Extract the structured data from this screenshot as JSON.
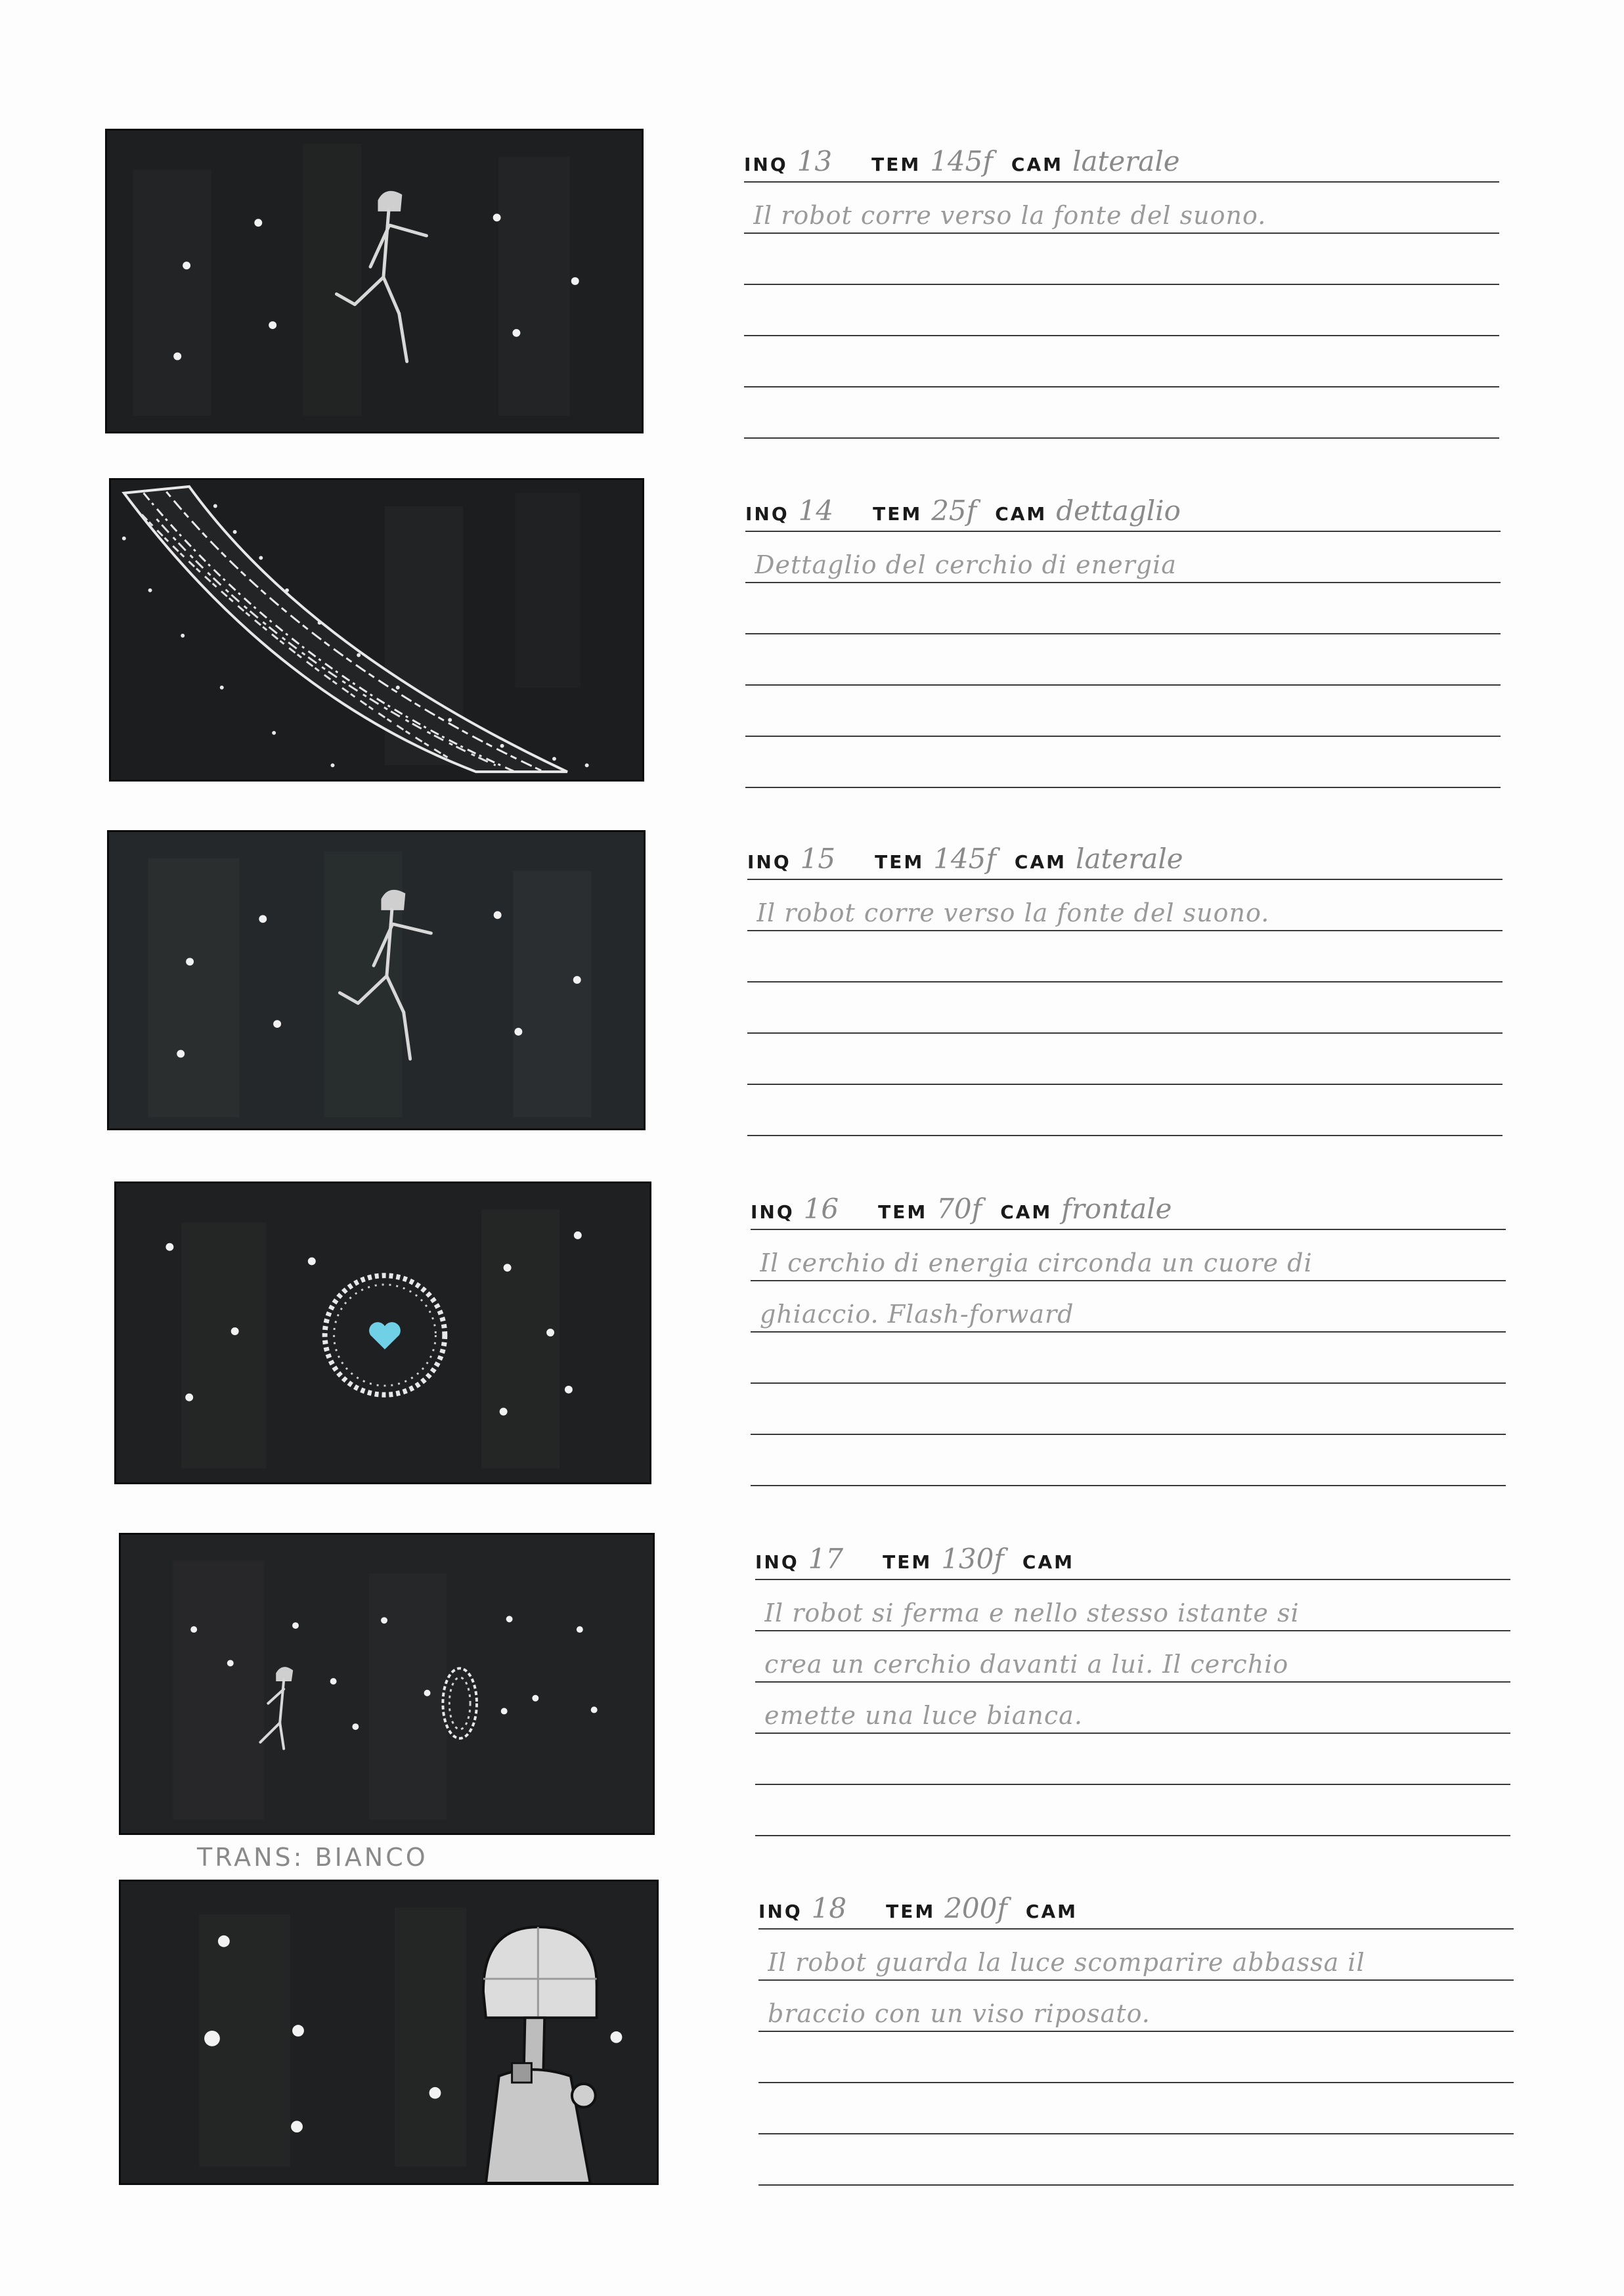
{
  "labels": {
    "inq": "INQ",
    "tem": "TEM",
    "cam": "CAM"
  },
  "shots": [
    {
      "inq": "13",
      "tem": "145f",
      "cam": "laterale",
      "lines": [
        "Il robot corre verso la fonte del suono.",
        "",
        "",
        "",
        ""
      ]
    },
    {
      "inq": "14",
      "tem": "25f",
      "cam": "dettaglio",
      "lines": [
        "Dettaglio del cerchio di energia",
        "",
        "",
        "",
        ""
      ]
    },
    {
      "inq": "15",
      "tem": "145f",
      "cam": "laterale",
      "lines": [
        "Il robot corre verso la fonte del suono.",
        "",
        "",
        "",
        ""
      ]
    },
    {
      "inq": "16",
      "tem": "70f",
      "cam": "frontale",
      "lines": [
        "Il cerchio di energia circonda un cuore di",
        "ghiaccio. Flash-forward",
        "",
        "",
        ""
      ]
    },
    {
      "inq": "17",
      "tem": "130f",
      "cam": "",
      "lines": [
        "Il robot si ferma e nello stesso istante si",
        "crea un cerchio davanti a lui. Il cerchio",
        "emette una luce bianca.",
        "",
        ""
      ]
    },
    {
      "inq": "18",
      "tem": "200f",
      "cam": "",
      "lines": [
        "Il robot guarda la luce scomparire abbassa il",
        "braccio con un viso riposato.",
        "",
        "",
        ""
      ]
    }
  ],
  "transition": "TRANS: BIANCO"
}
